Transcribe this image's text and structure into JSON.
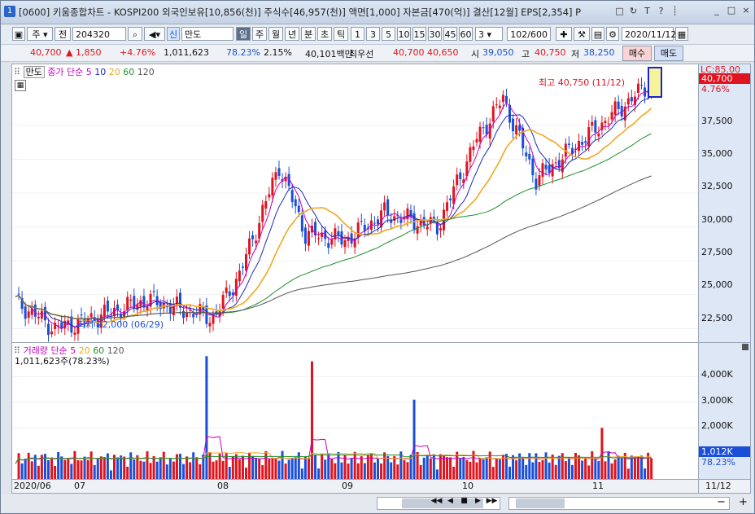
{
  "window": {
    "title": "[0600] 키움종합차트 - KOSPI200 외국인보유[10,856(천)] 주식수[46,957(천)] 액면[1,000] 자본금[470(억)] 결산[12월] EPS[2,354] P",
    "badge": "1",
    "title_icons": [
      "□",
      "↻",
      "T",
      "?",
      "┊"
    ],
    "controls": [
      "_",
      "□",
      "×"
    ]
  },
  "toolbar": {
    "type_label": "주",
    "period_label": "전",
    "code": "204320",
    "new_label": "신",
    "name": "만도",
    "periods": [
      "일",
      "주",
      "월",
      "년",
      "분",
      "초",
      "틱"
    ],
    "intervals": [
      "1",
      "3",
      "5",
      "10",
      "15",
      "30",
      "45",
      "60"
    ],
    "interval_value": "3",
    "count": "102/600",
    "date": "2020/11/12"
  },
  "quote": {
    "price": "40,700",
    "change": "▲ 1,850",
    "change_pct": "+4.76%",
    "volume": "1,011,623",
    "vol_pct": "78.23%",
    "turnover_pct": "2.15%",
    "amount": "40,101백만",
    "best_label": "최우선",
    "ask": "40,700",
    "bid": "40,650",
    "open_label": "시",
    "open": "39,050",
    "high_label": "고",
    "high": "40,750",
    "low_label": "저",
    "low": "38,250",
    "buy_label": "매수",
    "sell_label": "매도"
  },
  "legend": {
    "name": "만도",
    "price_ma": "종가 단순",
    "ma": [
      "5",
      "10",
      "20",
      "60",
      "120"
    ],
    "vol": "거래량",
    "vol_ma": "단순",
    "vol_ma_list": [
      "5",
      "20",
      "60",
      "120"
    ],
    "vol_value": "1,011,623주(78.23%)"
  },
  "annotations": {
    "high": "최고 40,750 (11/12)",
    "low": "최저 22,000 (06/29)"
  },
  "yaxis": {
    "ticks": [
      "37,500",
      "35,000",
      "32,500",
      "30,000",
      "27,500",
      "25,000",
      "22,500"
    ],
    "lc": "LC:85.00",
    "last": "40,700",
    "last_pct": "4.76%"
  },
  "vyaxis": {
    "ticks": [
      "4,000K",
      "3,000K",
      "2,000K"
    ],
    "last": "1,012K",
    "last_pct": "78.23%"
  },
  "xaxis": {
    "labels": [
      "2020/06",
      "07",
      "08",
      "09",
      "10",
      "11"
    ],
    "right": "11/12"
  },
  "bottom": {
    "nav": [
      "◀◀",
      "◀",
      "■",
      "▶",
      "▶▶"
    ],
    "zoom_out": "−",
    "zoom_in": "+"
  },
  "chart_data": {
    "type": "candlestick",
    "title": "만도",
    "x": [
      "06/26",
      "06/29",
      "07/01",
      "07/15",
      "08/03",
      "08/07",
      "08/14",
      "08/25",
      "09/01",
      "09/15",
      "09/29",
      "10/06",
      "10/14",
      "10/26",
      "11/02",
      "11/12"
    ],
    "close": [
      24500,
      22500,
      23000,
      24600,
      23300,
      26500,
      34500,
      29500,
      29000,
      31000,
      30000,
      36500,
      39500,
      33500,
      36000,
      40700
    ],
    "ylim": [
      21500,
      42000
    ],
    "colors": {
      "up": "#e0141e",
      "down": "#1a4fd8",
      "ma5": "#c400c4",
      "ma10": "#1e2bb8",
      "ma20": "#f0a820",
      "ma60": "#1f8f2e",
      "ma120": "#555555"
    }
  }
}
